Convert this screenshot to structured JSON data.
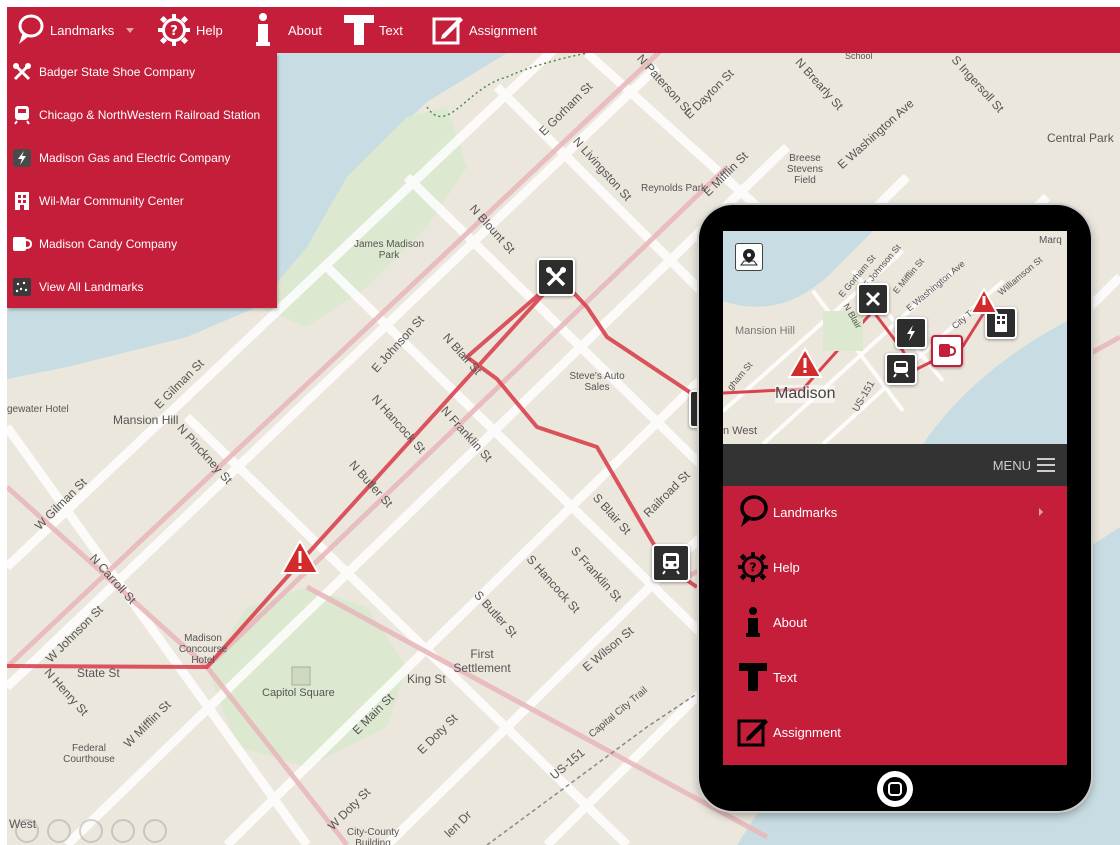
{
  "nav": {
    "landmarks": "Landmarks",
    "help": "Help",
    "about": "About",
    "text": "Text",
    "assignment": "Assignment"
  },
  "dropdown": {
    "items": [
      {
        "label": "Badger State Shoe Company",
        "icon": "tools-icon"
      },
      {
        "label": "Chicago & NorthWestern Railroad Station",
        "icon": "train-icon"
      },
      {
        "label": "Madison Gas and Electric Company",
        "icon": "lightning-icon"
      },
      {
        "label": "Wil-Mar Community Center",
        "icon": "building-icon"
      },
      {
        "label": "Madison Candy Company",
        "icon": "mug-icon"
      },
      {
        "label": "View All Landmarks",
        "icon": "dots-icon"
      }
    ]
  },
  "map": {
    "labels": {
      "gorham_st": "E Gorham St",
      "paterson_st": "N Paterson St",
      "dayton_st": "E Dayton St",
      "brearly_st": "N Brearly St",
      "washington_ave": "E Washington Ave",
      "ingersoll_st": "S Ingersoll St",
      "livingston_st": "N Livingston St",
      "mifflin_st": "E Mifflin St",
      "blount_st": "N Blount St",
      "central_park": "Central Park",
      "breese": "Breese Stevens Field",
      "reynolds": "Reynolds Park",
      "james_madison_park": "James Madison Park",
      "johnson_st": "E Johnson St",
      "blair_st": "N Blair St",
      "steves": "Steve's Auto Sales",
      "mansion_hill": "Mansion Hill",
      "gilman_st": "E Gilman St",
      "w_gilman_st": "W Gilman St",
      "pinckney_st": "N Pinckney St",
      "hancock_st": "N Hancock St",
      "franklin_st": "N Franklin St",
      "butler_st": "N Butler St",
      "railroad_st": "Railroad St",
      "s_blair_st": "S Blair St",
      "s_franklin_st": "S Franklin St",
      "s_hancock_st": "S Hancock St",
      "s_butler_st": "S Butler St",
      "first_settlement": "First Settlement",
      "wilson_st": "E Wilson St",
      "capitol_square": "Capitol Square",
      "king_st": "King St",
      "main_st": "E Main St",
      "doty_st": "E Doty St",
      "state_st": "State St",
      "carroll_st": "N Carroll St",
      "w_johnson_st": "W Johnson St",
      "henry_st": "N Henry St",
      "w_mifflin_st": "W Mifflin St",
      "concourse": "Madison Concourse Hotel",
      "federal_courthouse": "Federal Courthouse",
      "w_doty_st": "W Doty St",
      "city_county": "City-County Building",
      "capital_city_trail": "Capital City Trail",
      "us151": "US-151",
      "edgewater": "gewater Hotel",
      "school": "School",
      "west": "West",
      "blount_dr": "len Dr",
      "james_madison_park_small": "James Madison Park"
    }
  },
  "tablet": {
    "menu_label": "MENU",
    "map_labels": {
      "mansion_hill": "Mansion Hill",
      "madison": "Madison",
      "west": "n West",
      "us151": "US-151",
      "marq": "Marq",
      "gorham": "E Gorham St",
      "johnson": "E Johnson St",
      "mifflin": "E Mifflin St",
      "washington": "E Washington Ave",
      "williamson": "Williamson St",
      "city_trail": "City Trail",
      "blair": "N Blair",
      "gham": "gham St"
    },
    "items": [
      {
        "label": "Landmarks",
        "icon": "pin-icon"
      },
      {
        "label": "Help",
        "icon": "gear-help-icon"
      },
      {
        "label": "About",
        "icon": "info-icon"
      },
      {
        "label": "Text",
        "icon": "text-icon"
      },
      {
        "label": "Assignment",
        "icon": "edit-icon"
      }
    ]
  },
  "colors": {
    "brand_red": "#c41e3a",
    "lake": "#c8dde3",
    "route": "#d9434f"
  }
}
